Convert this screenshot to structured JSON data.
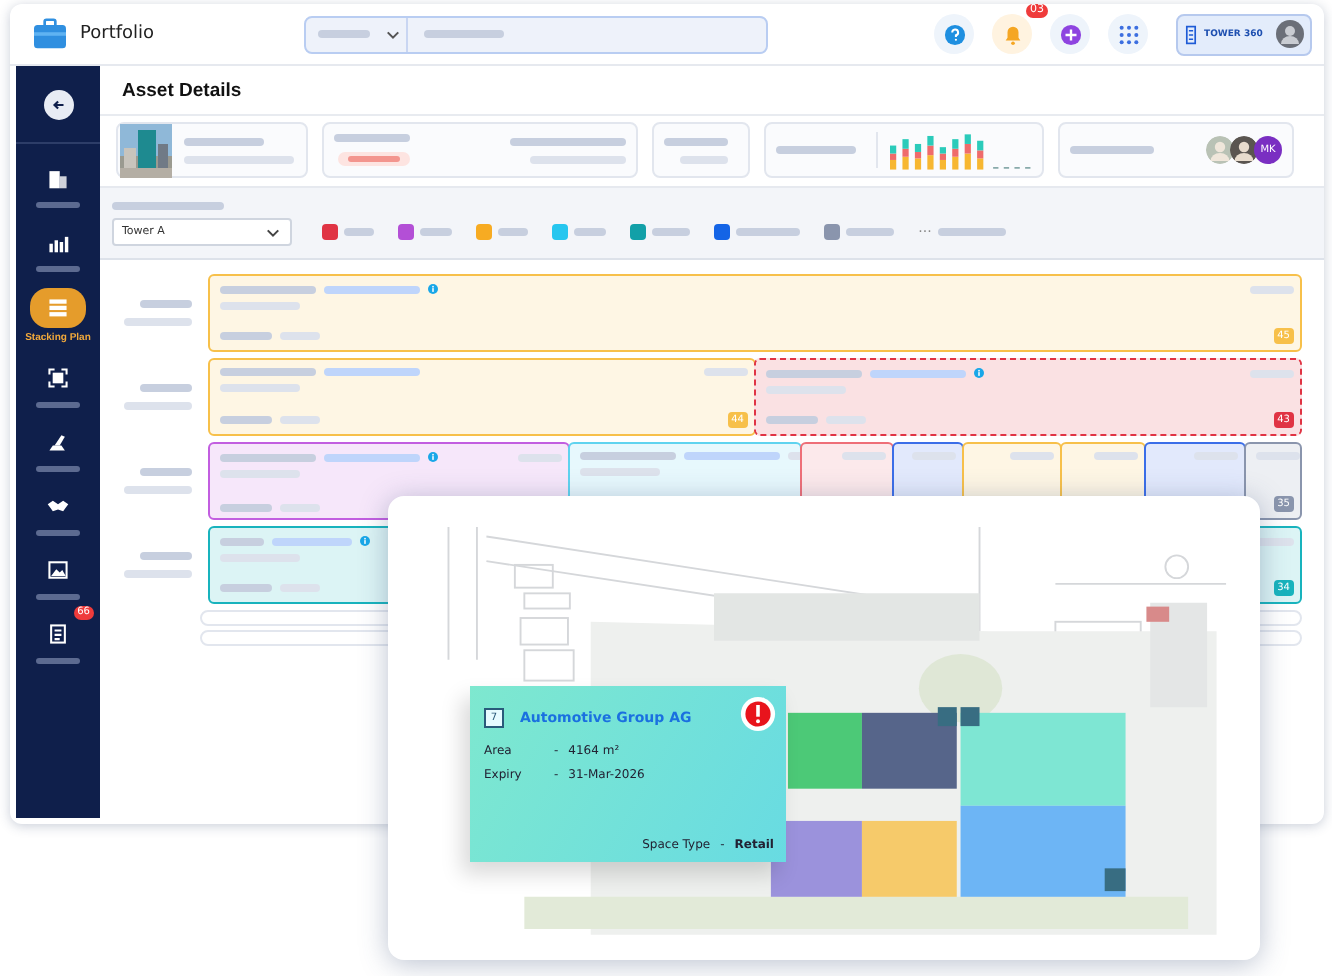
{
  "app": {
    "title": "Portfolio",
    "notifications": "03",
    "brand": "TOWER 360",
    "avatar_initials": "MK"
  },
  "sidebar": {
    "items": [
      {
        "selected": false
      },
      {
        "selected": false
      },
      {
        "selected": true,
        "label": "Stacking Plan"
      },
      {
        "selected": false
      },
      {
        "selected": false
      },
      {
        "selected": false
      },
      {
        "selected": false
      },
      {
        "selected": false,
        "badge": "66"
      }
    ]
  },
  "page": {
    "title": "Asset Details"
  },
  "filter": {
    "building": "Tower A",
    "more": "···"
  },
  "legend": [
    {
      "color": "#e03444"
    },
    {
      "color": "#b34fd6"
    },
    {
      "color": "#f7ab22"
    },
    {
      "color": "#26c6ef"
    },
    {
      "color": "#12a0a8"
    },
    {
      "color": "#1464e6"
    },
    {
      "color": "#8a95ad"
    }
  ],
  "floors": [
    {
      "units": [
        {
          "color": "#f7c04a",
          "badge": "45",
          "dashed": false,
          "info": true
        }
      ]
    },
    {
      "units": [
        {
          "color": "#f7c04a",
          "badge": "44",
          "dashed": false,
          "info": false
        },
        {
          "color": "#e03444",
          "badge": "43",
          "dashed": true,
          "info": true
        }
      ]
    },
    {
      "units": [
        {
          "color": "#c25ee0",
          "dashed": false,
          "info": true
        },
        {
          "color": "#5fd3ef",
          "dashed": false,
          "info": false
        },
        {
          "color": "#ee6f78",
          "dashed": false,
          "info": false
        },
        {
          "color": "#3b6ee8",
          "dashed": false,
          "info": false
        },
        {
          "color": "#f7c04a",
          "dashed": false,
          "info": false
        },
        {
          "color": "#f7c04a",
          "dashed": false,
          "info": false
        },
        {
          "color": "#3b6ee8",
          "dashed": false,
          "info": false
        },
        {
          "color": "#8a95ad",
          "badge": "35",
          "dashed": false,
          "info": false
        }
      ]
    },
    {
      "units": [
        {
          "color": "#18b3bd",
          "badge": "34",
          "dashed": false,
          "info": true
        }
      ]
    }
  ],
  "plan": {
    "popup": {
      "unit": "7",
      "tenant": "Automotive Group AG",
      "alert": true,
      "fields": [
        {
          "label": "Area",
          "sep": "-",
          "value": "4164 m²"
        },
        {
          "label": "Expiry",
          "sep": "-",
          "value": "31-Mar-2026"
        }
      ],
      "space_type": {
        "label": "Space Type",
        "sep": "-",
        "value": "Retail"
      }
    }
  }
}
